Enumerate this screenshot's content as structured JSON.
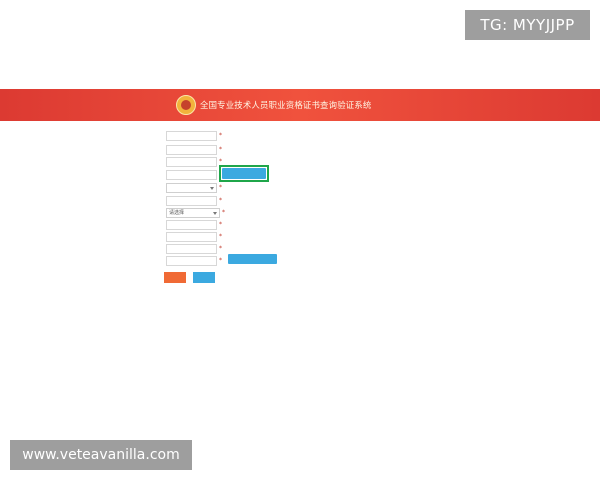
{
  "overlays": {
    "tag": "TG: MYYJJPP",
    "url": "www.veteavanilla.com"
  },
  "header": {
    "title": "全国专业技术人员职业资格证书查询验证系统",
    "bg_color": "#e2483a",
    "logo_icon": "emblem-icon"
  },
  "form": {
    "rows": [
      {
        "label": "",
        "hint": ""
      },
      {
        "label": "",
        "hint": ""
      },
      {
        "label": "",
        "hint": ""
      },
      {
        "label": "",
        "hint": ""
      },
      {
        "label": "",
        "hint": ""
      },
      {
        "label": "",
        "hint": ""
      },
      {
        "label": "",
        "hint": ""
      },
      {
        "label": "",
        "hint": ""
      },
      {
        "label": "",
        "hint": ""
      },
      {
        "label": "",
        "hint": ""
      },
      {
        "label": "",
        "hint": ""
      }
    ],
    "selects": [
      {
        "value": ""
      },
      {
        "value": "请选择"
      }
    ],
    "buttons": {
      "green_action": "",
      "blue_action": "",
      "submit": "",
      "reset": ""
    }
  },
  "colors": {
    "accent_green": "#1fa64a",
    "accent_blue": "#3ba9e0",
    "accent_orange": "#f06a35",
    "hint_red": "#c0392b"
  }
}
